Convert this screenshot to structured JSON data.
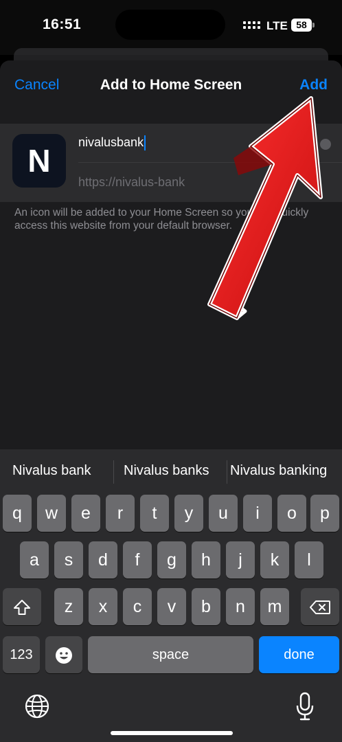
{
  "status_bar": {
    "time": "16:51",
    "network": "LTE",
    "battery": "58"
  },
  "sheet": {
    "cancel_label": "Cancel",
    "title": "Add to Home Screen",
    "add_label": "Add",
    "icon_letter": "N",
    "name_value": "nivalusbank",
    "url_value": "https://nivalus-bank",
    "hint_text": "An icon will be added to your Home Screen so you can quickly access this website from your default browser."
  },
  "keyboard": {
    "suggestions": [
      "Nivalus bank",
      "Nivalus banks",
      "Nivalus banking"
    ],
    "row1": [
      "q",
      "w",
      "e",
      "r",
      "t",
      "y",
      "u",
      "i",
      "o",
      "p"
    ],
    "row2": [
      "a",
      "s",
      "d",
      "f",
      "g",
      "h",
      "j",
      "k",
      "l"
    ],
    "row3": [
      "z",
      "x",
      "c",
      "v",
      "b",
      "n",
      "m"
    ],
    "numbers_label": "123",
    "space_label": "space",
    "done_label": "done"
  },
  "colors": {
    "accent": "#0a84ff",
    "sheet_bg": "#1c1c1e",
    "arrow": "#e11414"
  },
  "icons": [
    "shift-icon",
    "backspace-icon",
    "emoji-icon",
    "globe-icon",
    "mic-icon",
    "red-arrow-annotation"
  ]
}
